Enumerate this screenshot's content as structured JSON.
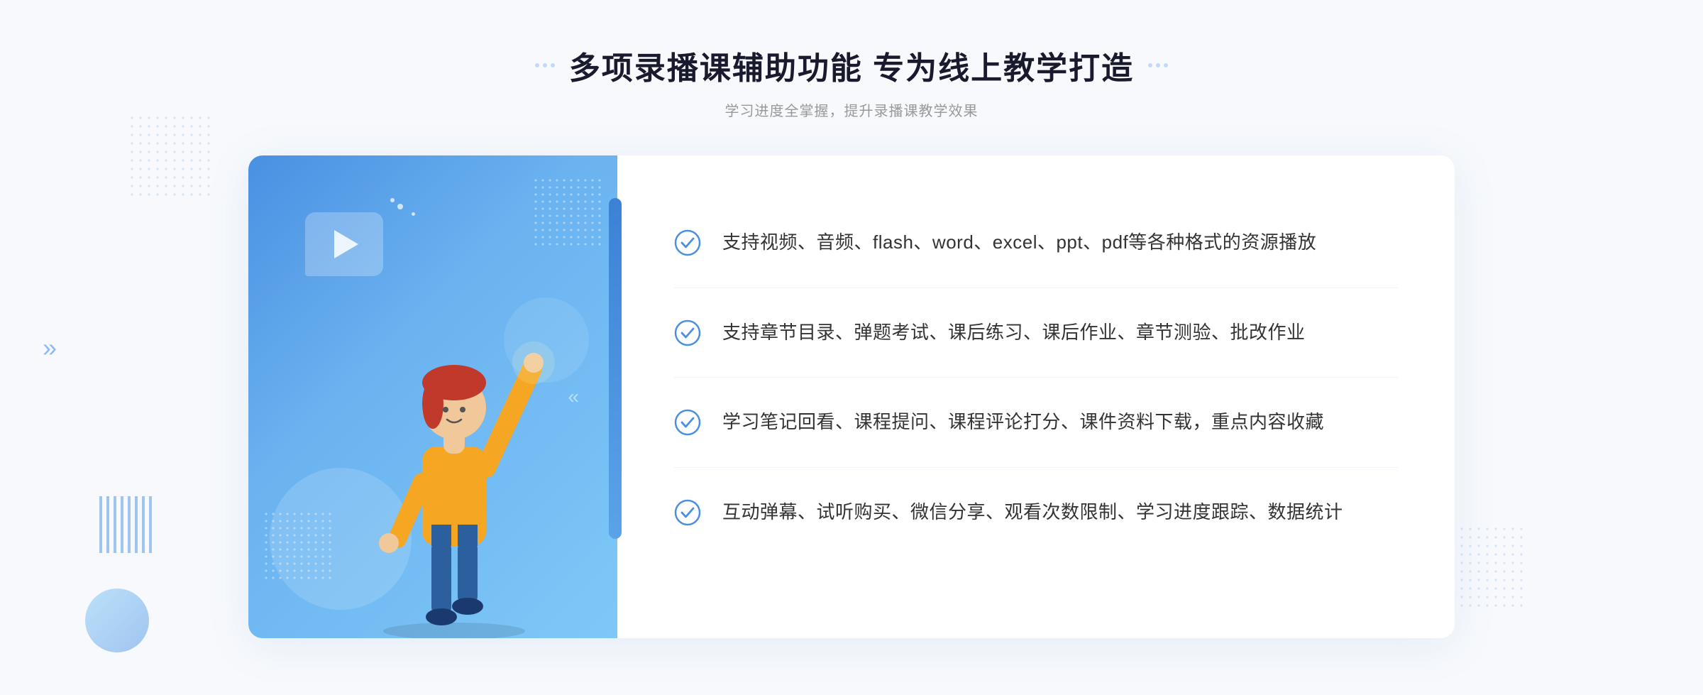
{
  "page": {
    "background": "#f7f9fc"
  },
  "header": {
    "title": "多项录播课辅助功能 专为线上教学打造",
    "subtitle": "学习进度全掌握，提升录播课教学效果",
    "dots_decoration": true
  },
  "features": [
    {
      "id": 1,
      "text": "支持视频、音频、flash、word、excel、ppt、pdf等各种格式的资源播放"
    },
    {
      "id": 2,
      "text": "支持章节目录、弹题考试、课后练习、课后作业、章节测验、批改作业"
    },
    {
      "id": 3,
      "text": "学习笔记回看、课程提问、课程评论打分、课件资料下载，重点内容收藏"
    },
    {
      "id": 4,
      "text": "互动弹幕、试听购买、微信分享、观看次数限制、学习进度跟踪、数据统计"
    }
  ],
  "icons": {
    "check": "check-circle-icon",
    "play": "play-icon",
    "chevron_left": "«",
    "chevron_right": "»"
  },
  "colors": {
    "primary": "#4a90e2",
    "primary_light": "#6bb3f0",
    "text_main": "#333333",
    "text_sub": "#999999",
    "title_color": "#1a1a2e",
    "check_color": "#4a90e2",
    "border_color": "#f0f4fa"
  }
}
